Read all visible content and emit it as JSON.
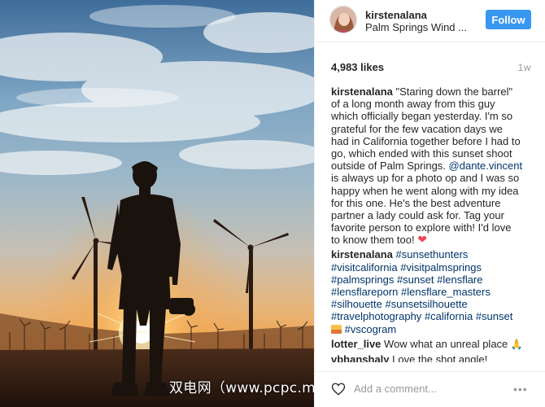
{
  "post": {
    "username": "kirstenalana",
    "location": "Palm Springs Wind ...",
    "follow_label": "Follow",
    "likes": "4,983 likes",
    "time": "1w"
  },
  "caption": {
    "username": "kirstenalana",
    "lines": [
      "\"Staring down the barrel\"",
      "of a long month away from this guy",
      "which officially began yesterday. I'm so",
      "grateful for the few vacation days we",
      "had in California together before I had to",
      "go, which ended with this sunset shoot",
      "outside of Palm Springs.",
      "@dante.vincent",
      "is always up for a photo op and I was so",
      "happy when he went along with my idea",
      "for this one. He's the best adventure",
      "partner a lady could ask for. Tag your",
      "favorite person to explore with! I'd love",
      "to know them too!"
    ]
  },
  "hashtags_comment": {
    "username": "kirstenalana",
    "tags": [
      "#sunsethunters",
      "#visitcalifornia",
      "#visitpalmsprings",
      "#palmsprings",
      "#sunset",
      "#lensflare",
      "#lensflareporn",
      "#lensflare_masters",
      "#silhouette",
      "#sunsetsilhouette",
      "#travelphotography",
      "#california",
      "#sunset",
      "#vscogram"
    ]
  },
  "comments": [
    {
      "username": "lotter_live",
      "text": "Wow what an unreal place"
    },
    {
      "username": "vbhanshaly",
      "text": "Love the shot angle!"
    }
  ],
  "comment_input": {
    "placeholder": "Add a comment..."
  },
  "watermark": "双电网（www.pcpc.me）",
  "icons": {
    "heart": "heart-icon",
    "more": "more-options-icon",
    "sunset_emoji": "sunset-emoji-icon",
    "pray_emoji": "pray-emoji-icon"
  },
  "colors": {
    "follow_button": "#3897f0",
    "link": "#003569",
    "heart": "#ed4956",
    "muted": "#999999"
  }
}
